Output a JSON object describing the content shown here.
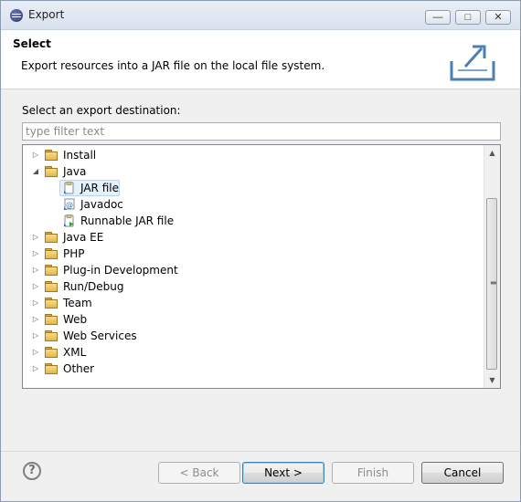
{
  "window": {
    "title": "Export",
    "controls": [
      "minimize",
      "restore",
      "close"
    ]
  },
  "banner": {
    "title": "Select",
    "description": "Export resources into a JAR file on the local file system.",
    "icon": "export-wizard-icon"
  },
  "filter": {
    "label": "Select an export destination:",
    "placeholder": "type filter text",
    "value": ""
  },
  "tree": {
    "items": [
      {
        "label": "Install",
        "expanded": false
      },
      {
        "label": "Java",
        "expanded": true,
        "children": [
          {
            "label": "JAR file",
            "icon": "jar-file-icon",
            "selected": true
          },
          {
            "label": "Javadoc",
            "icon": "javadoc-icon"
          },
          {
            "label": "Runnable JAR file",
            "icon": "runnable-jar-icon"
          }
        ]
      },
      {
        "label": "Java EE",
        "expanded": false
      },
      {
        "label": "PHP",
        "expanded": false
      },
      {
        "label": "Plug-in Development",
        "expanded": false
      },
      {
        "label": "Run/Debug",
        "expanded": false
      },
      {
        "label": "Team",
        "expanded": false
      },
      {
        "label": "Web",
        "expanded": false
      },
      {
        "label": "Web Services",
        "expanded": false
      },
      {
        "label": "XML",
        "expanded": false
      },
      {
        "label": "Other",
        "expanded": false
      }
    ]
  },
  "buttons": {
    "back": "< Back",
    "next": "Next >",
    "finish": "Finish",
    "cancel": "Cancel"
  },
  "colors": {
    "selection": "#e5f1fb",
    "folder": "#e3b84d"
  }
}
